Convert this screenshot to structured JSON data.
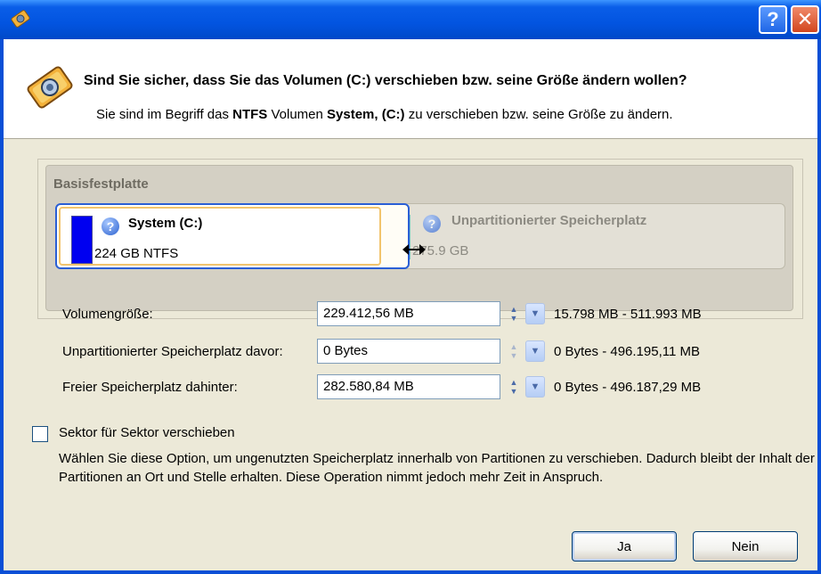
{
  "window": {
    "icon": "app-gear-icon",
    "help_button": "?",
    "close_button": "✕"
  },
  "header": {
    "title": "Sind Sie sicher, dass Sie das Volumen (C:) verschieben bzw. seine Größe ändern wollen?",
    "sub_prefix": "Sie sind im Begriff das ",
    "sub_fs": "NTFS",
    "sub_mid": " Volumen ",
    "sub_volume": "System, (C:)",
    "sub_suffix": " zu verschieben bzw. seine Größe zu ändern."
  },
  "disk": {
    "label": "Basisfestplatte",
    "system": {
      "name": "System (C:)",
      "size": "224 GB NTFS"
    },
    "unpartitioned": {
      "name": "Unpartitionierter Speicherplatz",
      "size": "275.9 GB"
    }
  },
  "fields": [
    {
      "label": "Volumengröße:",
      "value": "229.412,56 MB",
      "range": "15.798 MB - 511.993 MB"
    },
    {
      "label": "Unpartitionierter Speicherplatz davor:",
      "value": "0 Bytes",
      "range": "0 Bytes - 496.195,11 MB"
    },
    {
      "label": "Freier Speicherplatz dahinter:",
      "value": "282.580,84 MB",
      "range": "0 Bytes - 496.187,29 MB"
    }
  ],
  "option": {
    "label": "Sektor für Sektor verschieben",
    "checked": false,
    "description": "Wählen Sie diese Option, um ungenutzten Speicherplatz innerhalb von Partitionen zu verschieben. Dadurch bleibt der Inhalt der Partitionen an Ort und Stelle erhalten. Diese Operation nimmt jedoch mehr Zeit in Anspruch."
  },
  "buttons": {
    "yes": "Ja",
    "no": "Nein"
  },
  "colors": {
    "titlebar": "#0254e0",
    "system_bar": "#0000f0",
    "selection": "#2a5fd6",
    "unpartitioned_bar": "#2f9fa0"
  }
}
